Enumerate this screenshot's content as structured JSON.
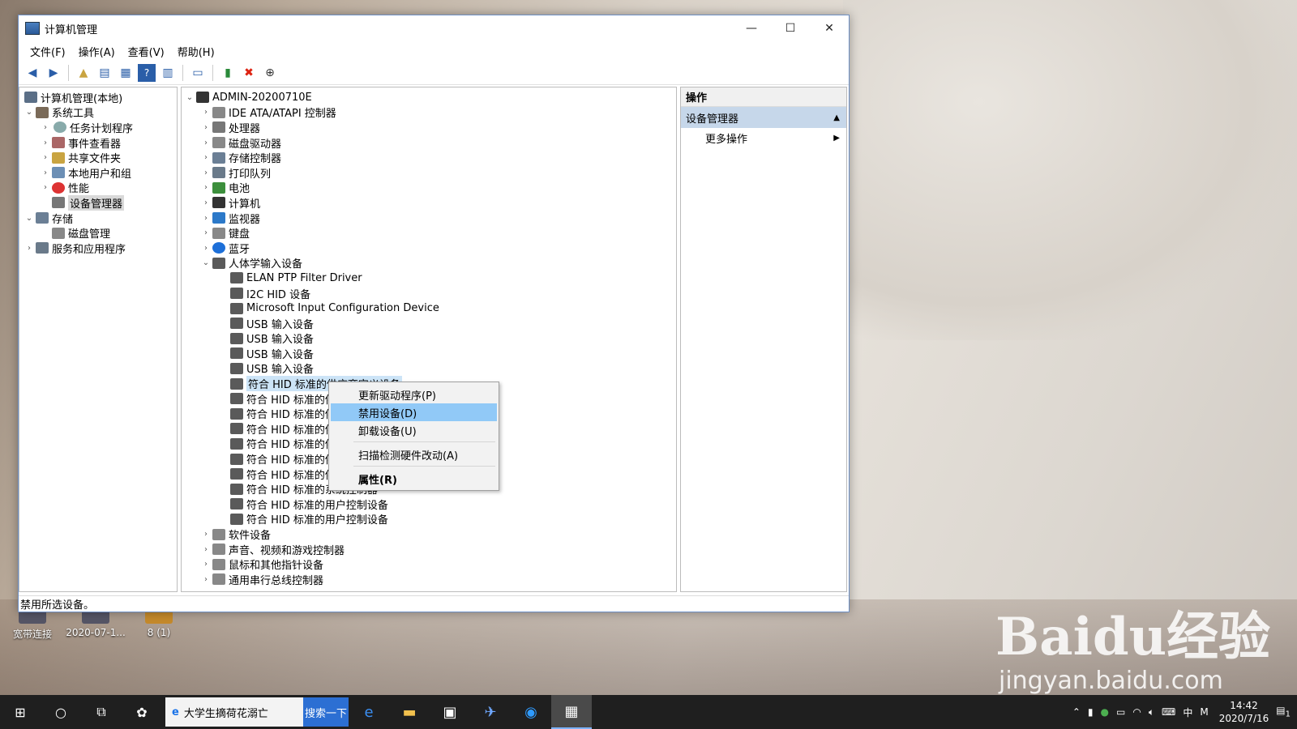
{
  "window": {
    "title": "计算机管理",
    "controls": {
      "minimize": "—",
      "maximize": "☐",
      "close": "✕"
    }
  },
  "menu": [
    "文件(F)",
    "操作(A)",
    "查看(V)",
    "帮助(H)"
  ],
  "left_tree": {
    "root": "计算机管理(本地)",
    "system_tools": "系统工具",
    "items": [
      "任务计划程序",
      "事件查看器",
      "共享文件夹",
      "本地用户和组",
      "性能",
      "设备管理器"
    ],
    "storage": "存储",
    "disk_mgmt": "磁盘管理",
    "services": "服务和应用程序"
  },
  "device_tree": {
    "computer": "ADMIN-20200710E",
    "categories_top": [
      "IDE ATA/ATAPI 控制器",
      "处理器",
      "磁盘驱动器",
      "存储控制器",
      "打印队列",
      "电池",
      "计算机",
      "监视器",
      "键盘",
      "蓝牙"
    ],
    "hid_category": "人体学输入设备",
    "hid_devices": [
      "ELAN PTP Filter Driver",
      "I2C HID 设备",
      "Microsoft Input Configuration Device",
      "USB 输入设备",
      "USB 输入设备",
      "USB 输入设备",
      "USB 输入设备",
      "符合 HID 标准的供应商定义设备",
      "符合 HID 标准的供",
      "符合 HID 标准的供",
      "符合 HID 标准的供",
      "符合 HID 标准的供",
      "符合 HID 标准的供",
      "符合 HID 标准的供",
      "符合 HID 标准的系统控制器",
      "符合 HID 标准的用户控制设备",
      "符合 HID 标准的用户控制设备"
    ],
    "categories_bottom": [
      "软件设备",
      "声音、视频和游戏控制器",
      "鼠标和其他指针设备",
      "通用串行总线控制器"
    ]
  },
  "context_menu": {
    "update_driver": "更新驱动程序(P)",
    "disable_device": "禁用设备(D)",
    "uninstall_device": "卸载设备(U)",
    "scan_hardware": "扫描检测硬件改动(A)",
    "properties": "属性(R)"
  },
  "actions_pane": {
    "header": "操作",
    "group": "设备管理器",
    "more": "更多操作"
  },
  "status_bar": "禁用所选设备。",
  "desktop_icons": [
    "宽带连接",
    "2020-07-1...",
    "8 (1)"
  ],
  "taskbar": {
    "search_text": "大学生摘荷花溺亡",
    "search_button": "搜索一下",
    "ime": "中",
    "ime_mode": "M",
    "time": "14:42",
    "date": "2020/7/16",
    "notification_count": "1"
  },
  "watermark": {
    "brand": "Baidu经验",
    "url": "jingyan.baidu.com"
  },
  "colors": {
    "selection": "#cce4f7",
    "menu_highlight": "#91c9f7",
    "actions_group": "#c6d7ea",
    "taskbar": "#1f1f1f"
  }
}
